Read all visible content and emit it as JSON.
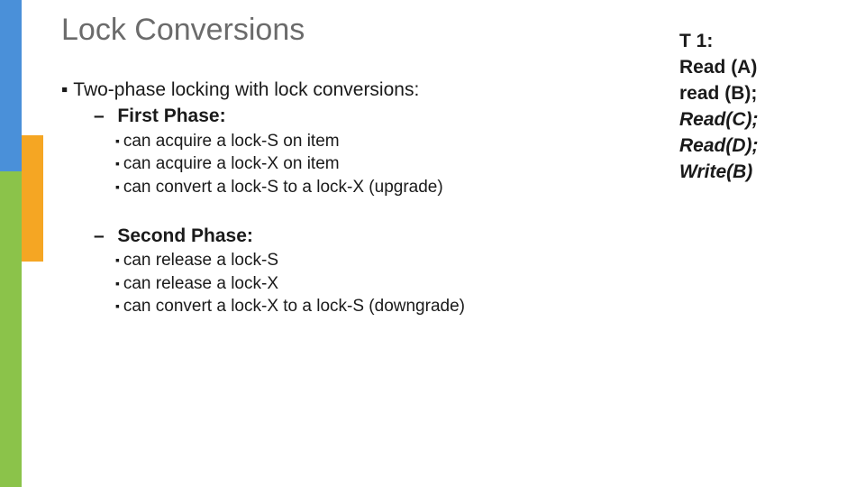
{
  "title": "Lock Conversions",
  "intro": "Two-phase locking with lock conversions:",
  "phase1_label": "First Phase:",
  "phase1_items": {
    "a": "can acquire a lock-S on item",
    "b": "can acquire a lock-X on item",
    "c": "can convert a lock-S to a lock-X (upgrade)"
  },
  "phase2_label": "Second Phase:",
  "phase2_items": {
    "a": "can release a lock-S",
    "b": "can release a lock-X",
    "c": "can convert a lock-X to a lock-S  (downgrade)"
  },
  "t1": {
    "header": "T 1:",
    "l1a": "Read ",
    "l1b": "(A)",
    "l2a": "read ",
    "l2b": "(B);",
    "l3": "Read(C);",
    "l4": "Read(D);",
    "l5": "Write(B)"
  }
}
